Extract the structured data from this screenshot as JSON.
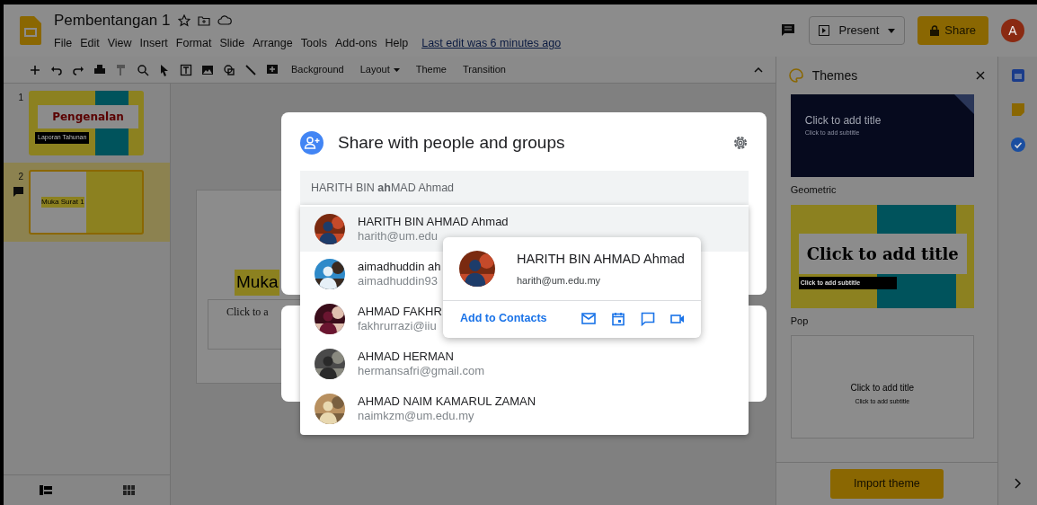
{
  "app": {
    "title": "Pembentangan 1",
    "menu": [
      "File",
      "Edit",
      "View",
      "Insert",
      "Format",
      "Slide",
      "Arrange",
      "Tools",
      "Add-ons",
      "Help"
    ],
    "last_edit": "Last edit was 6 minutes ago",
    "present_label": "Present",
    "share_label": "Share",
    "account_initial": "A"
  },
  "toolbar": {
    "buttons": [
      {
        "label": "Background",
        "dropdown": false
      },
      {
        "label": "Layout",
        "dropdown": true
      },
      {
        "label": "Theme",
        "dropdown": false
      },
      {
        "label": "Transition",
        "dropdown": false
      }
    ]
  },
  "filmstrip": {
    "slides": [
      {
        "number": "1",
        "kind": "title",
        "title": "Pengenalan",
        "subtitle": "Laporan Tahunan",
        "selected": false,
        "has_comment": false
      },
      {
        "number": "2",
        "kind": "split",
        "title": "Muka Surat 1",
        "selected": true,
        "has_comment": true
      }
    ]
  },
  "canvas": {
    "title": "Muka",
    "body": "Click to a"
  },
  "themes": {
    "title": "Themes",
    "items": [
      {
        "kind": "dark",
        "title": "Click to add title",
        "subtitle": "Click to add subtitle",
        "name": "Geometric"
      },
      {
        "kind": "pop",
        "title": "Click to add title",
        "subtitle": "Click to add subtitle",
        "name": "Pop"
      },
      {
        "kind": "light",
        "title": "Click to add title",
        "subtitle": "Click to add subtitle"
      }
    ],
    "import_label": "Import theme"
  },
  "dialog": {
    "title": "Share with people and groups",
    "query": "HARITH BIN **ah**MAD Ahmad",
    "suggestions": [
      {
        "name": "HARITH BIN AHMAD Ahmad",
        "email": "harith@um.edu",
        "selected": true
      },
      {
        "name": "aimadhuddin ah",
        "email": "aimadhuddin93",
        "selected": false
      },
      {
        "name": "AHMAD FAKHR",
        "email": "fakhrurrazi@iiu",
        "selected": false
      },
      {
        "name": "AHMAD HERMAN",
        "email": "hermansafri@gmail.com",
        "selected": false
      },
      {
        "name": "AHMAD NAIM KAMARUL ZAMAN",
        "email": "naimkzm@um.edu.my",
        "selected": false
      }
    ],
    "contact_card": {
      "name": "HARITH BIN AHMAD Ahmad",
      "email": "harith@um.edu.my",
      "action": "Add to Contacts"
    }
  }
}
